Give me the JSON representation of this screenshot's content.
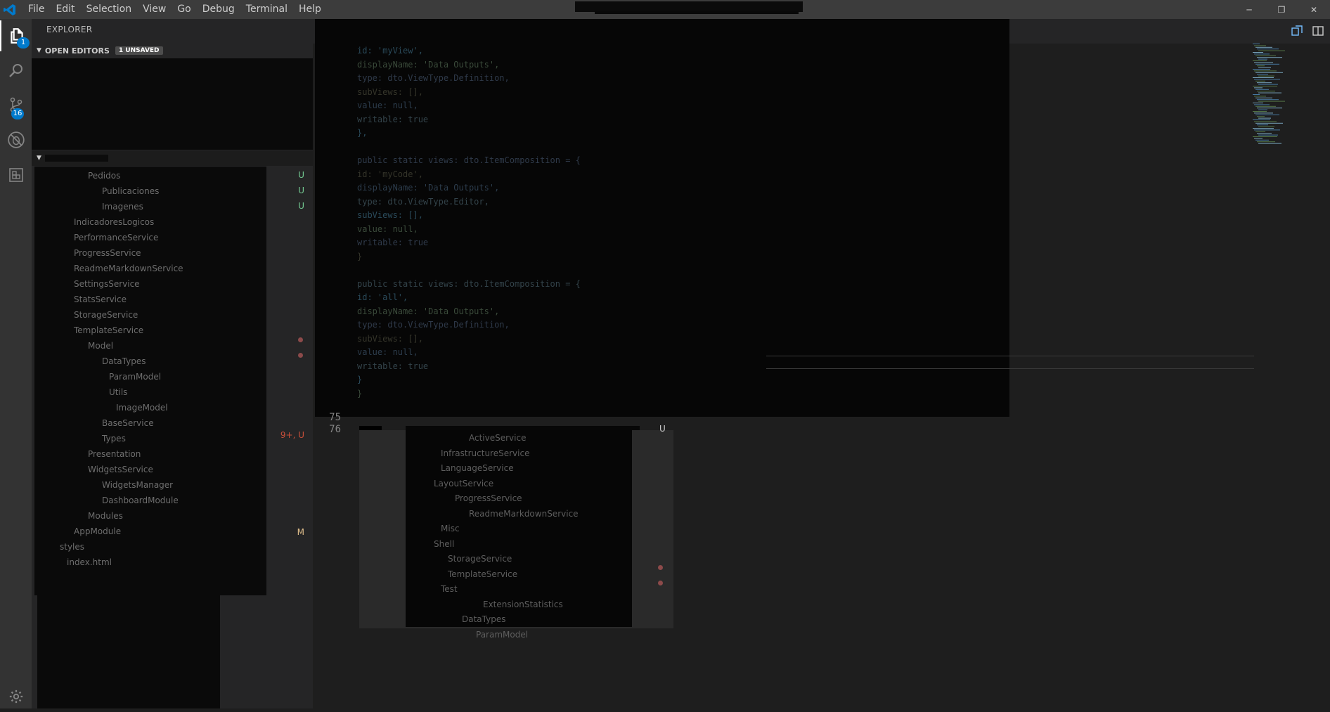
{
  "menu": [
    "File",
    "Edit",
    "Selection",
    "View",
    "Go",
    "Debug",
    "Terminal",
    "Help"
  ],
  "window_controls": {
    "minimize": "─",
    "restore": "❐",
    "close": "✕"
  },
  "activity": {
    "explorer_badge": "1",
    "scm_badge": "16",
    "icons": [
      "files-icon",
      "search-icon",
      "source-control-icon",
      "debug-icon",
      "extensions-icon",
      "settings-gear-icon"
    ]
  },
  "sidebar": {
    "title": "EXPLORER",
    "open_editors_label": "OPEN EDITORS",
    "unsaved_badge": "1 UNSAVED",
    "decorations": [
      {
        "text": "U",
        "color": "#73c991"
      },
      {
        "text": "U",
        "color": "#73c991"
      },
      {
        "text": "U",
        "color": "#73c991"
      },
      {
        "text": "9+, U",
        "color": "#c74e39"
      },
      {
        "text": "M",
        "color": "#e2c08d"
      }
    ],
    "tree_rows": [
      "Pedidos",
      "Publicaciones",
      "Imagenes",
      "IndicadoresLogicos",
      "PerformanceService",
      "ProgressService",
      "ReadmeMarkdownService",
      "SettingsService",
      "StatsService",
      "StorageService",
      "TemplateService",
      "Model",
      "DataTypes",
      "ParamModel",
      "Utils",
      "ImageModel",
      "BaseService",
      "Types",
      "Presentation",
      "WidgetsService",
      "WidgetsManager",
      "DashboardModule",
      "Modules",
      "AppModule",
      "styles",
      "index.html"
    ]
  },
  "editor": {
    "line_numbers": [
      {
        "n": "75"
      },
      {
        "n": "76"
      }
    ],
    "code_lines": [
      "    id: 'myView',",
      "    displayName: 'Data Outputs',",
      "    type: dto.ViewType.Definition,",
      "    subViews: [],",
      "    value: null,",
      "    writable: true",
      "  },",
      "",
      "  public static views: dto.ItemComposition = {",
      "    id: 'myCode',",
      "    displayName: 'Data Outputs',",
      "    type: dto.ViewType.Editor,",
      "    subViews: [],",
      "    value: null,",
      "    writable: true",
      "  }",
      "",
      "  public static views: dto.ItemComposition = {",
      "    id: 'all',",
      "    displayName: 'Data Outputs',",
      "    type: dto.ViewType.Definition,",
      "    subViews: [],",
      "    value: null,",
      "    writable: true",
      "  }",
      "}"
    ],
    "panel_rows": [
      "ActiveService",
      "InfrastructureService",
      "LanguageService",
      "LayoutService",
      "ProgressService",
      "ReadmeMarkdownService",
      "Misc",
      "Shell",
      "StorageService",
      "TemplateService",
      "Test",
      "ExtensionStatistics",
      "DataTypes",
      "ParamModel"
    ],
    "panel_badge": {
      "text": "U",
      "color": "#73c991"
    }
  },
  "colors": {
    "accent": "#007acc",
    "title_bar": "#3c3c3c",
    "activity_bar": "#333333",
    "sidebar": "#252526",
    "editor": "#1e1e1e"
  }
}
